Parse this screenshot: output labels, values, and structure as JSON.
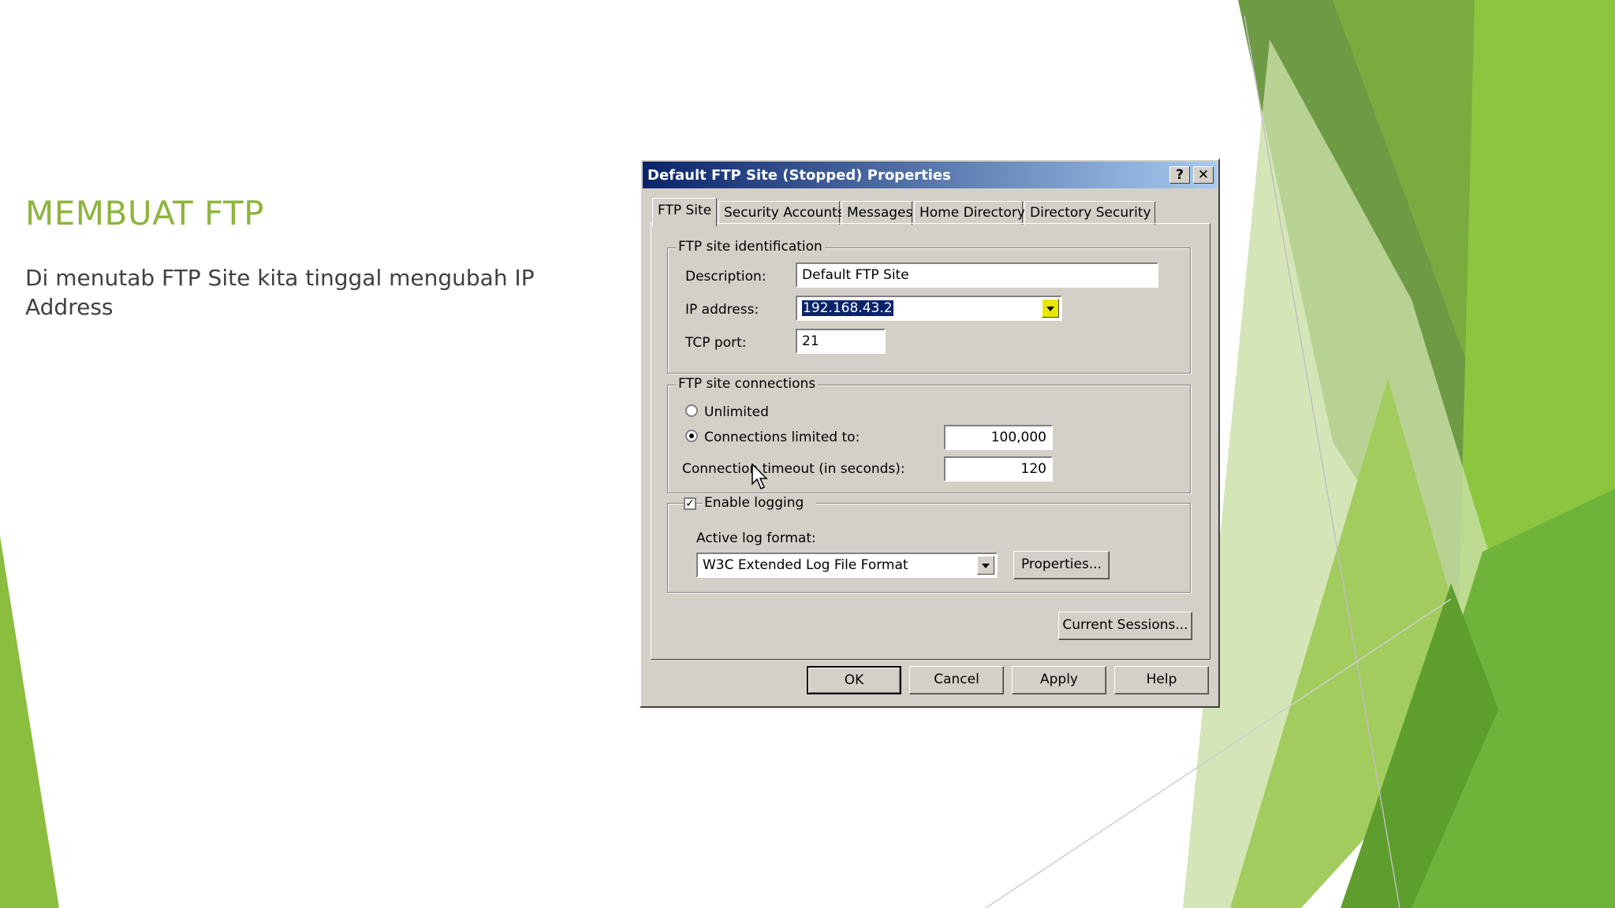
{
  "slide": {
    "title": "MEMBUAT FTP",
    "body": "Di menutab FTP Site kita tinggal mengubah IP Address"
  },
  "dialog": {
    "title": "Default FTP Site (Stopped) Properties",
    "help_btn": "?",
    "close_btn": "✕",
    "tabs": [
      {
        "label": "FTP Site",
        "active": true
      },
      {
        "label": "Security Accounts",
        "active": false
      },
      {
        "label": "Messages",
        "active": false
      },
      {
        "label": "Home Directory",
        "active": false
      },
      {
        "label": "Directory Security",
        "active": false
      }
    ],
    "identification": {
      "group_label": "FTP site identification",
      "description_label": "Description:",
      "description_value": "Default FTP Site",
      "ip_label": "IP address:",
      "ip_value": "192.168.43.2",
      "port_label": "TCP port:",
      "port_value": "21"
    },
    "connections": {
      "group_label": "FTP site connections",
      "unlimited_label": "Unlimited",
      "unlimited_selected": false,
      "limited_label": "Connections limited to:",
      "limited_selected": true,
      "limited_value": "100,000",
      "timeout_label": "Connection timeout (in seconds):",
      "timeout_value": "120"
    },
    "logging": {
      "enable_label": "Enable logging",
      "enabled": true,
      "format_label": "Active log format:",
      "format_value": "W3C Extended Log File Format",
      "properties_button": "Properties..."
    },
    "current_sessions_button": "Current Sessions...",
    "buttons": {
      "ok": "OK",
      "cancel": "Cancel",
      "apply": "Apply",
      "help": "Help"
    }
  },
  "colors": {
    "title_green": "#8db53c",
    "dialog_face": "#d4d0c8",
    "highlight_yellow": "#e8e800"
  }
}
